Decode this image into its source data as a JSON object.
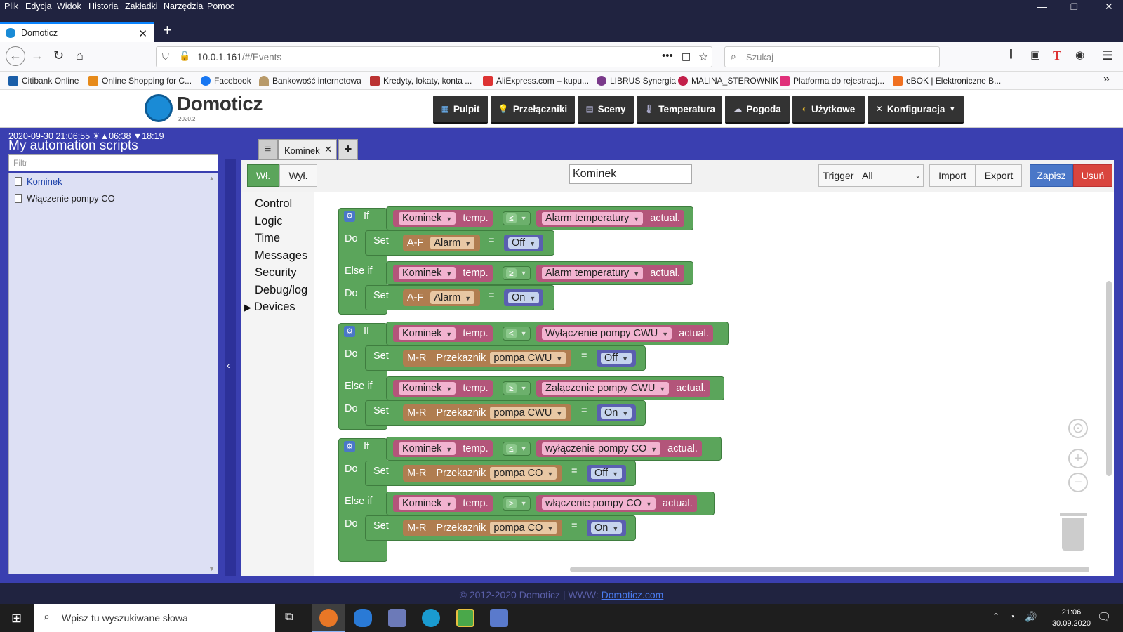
{
  "browser": {
    "menu": [
      "Plik",
      "Edycja",
      "Widok",
      "Historia",
      "Zakładki",
      "Narzędzia",
      "Pomoc"
    ],
    "tab_title": "Domoticz",
    "url_host": "10.0.1.161",
    "url_path": "/#/Events",
    "search_placeholder": "Szukaj",
    "bookmarks": [
      "Citibank Online",
      "Online Shopping for C...",
      "Facebook",
      "Bankowość internetowa",
      "Kredyty, lokaty, konta ...",
      "AliExpress.com – kupu...",
      "LIBRUS Synergia",
      "MALINA_STEROWNIK",
      "Platforma do rejestracj...",
      "eBOK | Elektroniczne B..."
    ]
  },
  "app": {
    "name": "Domoticz",
    "version": "2020.2",
    "nav": [
      "Pulpit",
      "Przełączniki",
      "Sceny",
      "Temperatura",
      "Pogoda",
      "Użytkowe",
      "Konfiguracja"
    ],
    "status_line": "2020-09-30 21:06:55 ☀▲06:38 ▼18:19",
    "panel_title": "My automation scripts",
    "filter_placeholder": "Filtr",
    "scripts": [
      "Kominek",
      "Włączenie pompy CO"
    ],
    "footer_text": "© 2012-2020 Domoticz | WWW: ",
    "footer_link": "Domoticz.com"
  },
  "editor": {
    "tab_label": "Kominek",
    "on_label": "Wł.",
    "off_label": "Wył.",
    "event_name": "Kominek",
    "trigger_label": "Trigger",
    "trigger_value": "All",
    "import_label": "Import",
    "export_label": "Export",
    "save_label": "Zapisz",
    "delete_label": "Usuń",
    "toolbox": [
      "Control",
      "Logic",
      "Time",
      "Messages",
      "Security",
      "Debug/log",
      "Devices"
    ],
    "words": {
      "if": "If",
      "do": "Do",
      "elseif": "Else if",
      "set": "Set",
      "eq": "=",
      "temp": "temp.",
      "actual": "actual.",
      "le": "≤",
      "ge": "≥"
    },
    "groups": [
      {
        "dev": "Kominek",
        "rows": [
          {
            "cond": "≤",
            "ref": "Alarm temperatury",
            "prefix": "A-F",
            "target": "Alarm",
            "target_kind": "pink",
            "val": "Off"
          },
          {
            "cond": "≥",
            "ref": "Alarm temperatury",
            "prefix": "A-F",
            "target": "Alarm",
            "target_kind": "pink",
            "val": "On"
          }
        ]
      },
      {
        "dev": "Kominek",
        "rows": [
          {
            "cond": "≤",
            "ref": "Wyłączenie pompy CWU",
            "prefix": "M-R",
            "sub": "Przekaznik",
            "target": "pompa CWU",
            "val": "Off"
          },
          {
            "cond": "≥",
            "ref": "Załączenie pompy CWU",
            "prefix": "M-R",
            "sub": "Przekaznik",
            "target": "pompa CWU",
            "val": "On"
          }
        ]
      },
      {
        "dev": "Kominek",
        "rows": [
          {
            "cond": "≤",
            "ref": "wyłączenie pompy CO",
            "prefix": "M-R",
            "sub": "Przekaznik",
            "target": "pompa CO",
            "val": "Off"
          },
          {
            "cond": "≥",
            "ref": "włączenie pompy CO",
            "prefix": "M-R",
            "sub": "Przekaznik",
            "target": "pompa CO",
            "val": "On"
          }
        ]
      }
    ]
  },
  "taskbar": {
    "search_placeholder": "Wpisz tu wyszukiwane słowa",
    "time": "21:06",
    "date": "30.09.2020"
  },
  "colors": {
    "accent": "#1a8bd6",
    "block_green": "#5ba55b",
    "device_pink": "#b3557a",
    "save": "#4a77c8",
    "delete": "#d9453e",
    "panel": "#3a3fb0"
  }
}
